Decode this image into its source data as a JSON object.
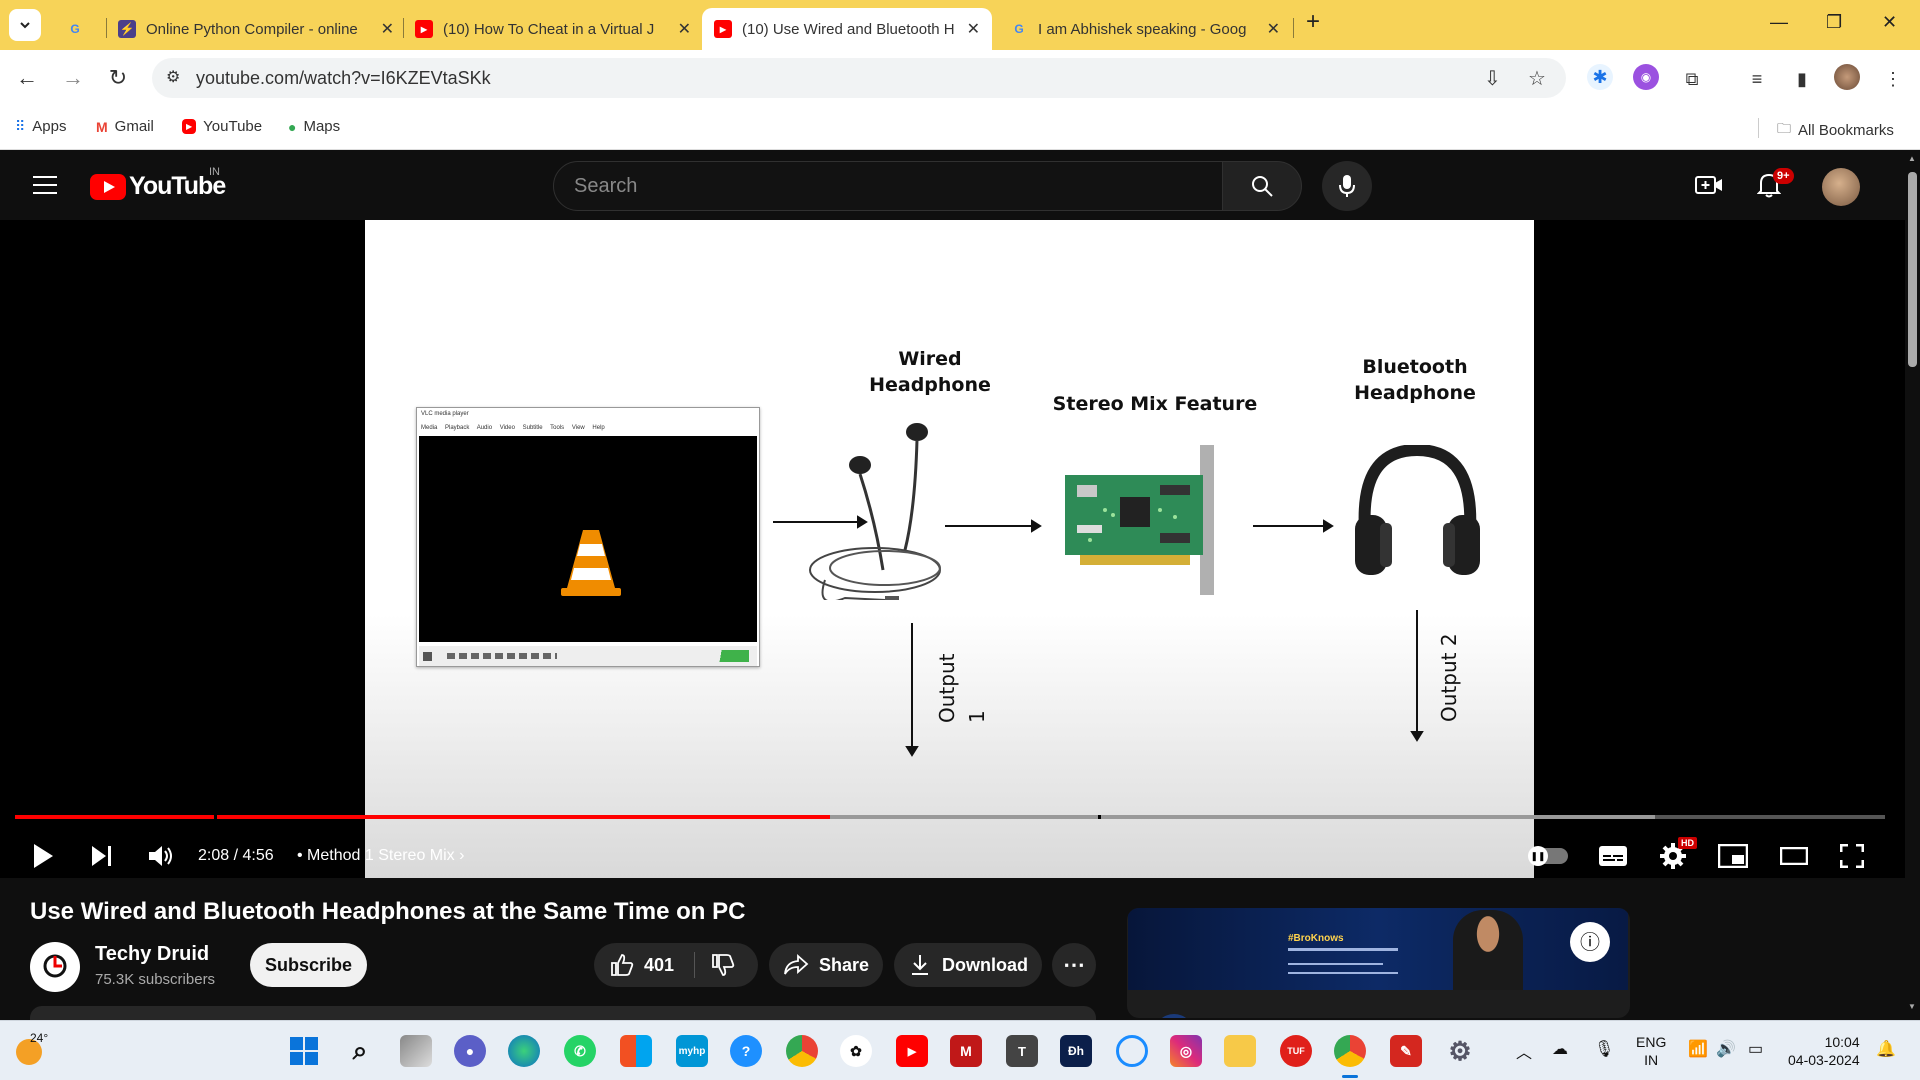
{
  "browser": {
    "tabs": [
      {
        "title": "Online Python Compiler - online",
        "icon": "lightning-icon"
      },
      {
        "title": "(10) How To Cheat in a Virtual J",
        "icon": "youtube-icon"
      },
      {
        "title": "(10) Use Wired and Bluetooth H",
        "icon": "youtube-icon",
        "active": true
      },
      {
        "title": "I am Abhishek speaking - Goog",
        "icon": "google-icon"
      }
    ],
    "url": "youtube.com/watch?v=I6KZEVtaSKk",
    "bookmarks": [
      "Apps",
      "Gmail",
      "YouTube",
      "Maps"
    ],
    "all_bookmarks": "All Bookmarks"
  },
  "youtube": {
    "logo_text": "YouTube",
    "country": "IN",
    "search_placeholder": "Search",
    "notifications": "9+"
  },
  "video": {
    "slide": {
      "wired": "Wired\nHeadphone",
      "stereo": "Stereo Mix Feature",
      "bluetooth": "Bluetooth\nHeadphone",
      "output1": "Output\n1",
      "output2": "Output 2",
      "vlc_title": "VLC media player",
      "vlc_menu": "Media Playback Audio Video Subtitle Tools View Help"
    },
    "time": "2:08 / 4:56",
    "chapter": "Method 1 Stereo Mix",
    "hd_badge": "HD",
    "progress_fraction": 0.436
  },
  "info": {
    "title": "Use Wired and Bluetooth Headphones at the Same Time on PC",
    "channel": "Techy Druid",
    "subscribers": "75.3K subscribers",
    "subscribe": "Subscribe",
    "likes": "401",
    "share": "Share",
    "download": "Download",
    "ad_text": "#BroKnows"
  },
  "taskbar": {
    "weather": "24°",
    "lang1": "ENG",
    "lang2": "IN",
    "time": "10:04",
    "date": "04-03-2024"
  },
  "colors": {
    "tabstrip": "#f7d358",
    "yt_red": "#ff0000",
    "progress_red": "#ff0000"
  }
}
